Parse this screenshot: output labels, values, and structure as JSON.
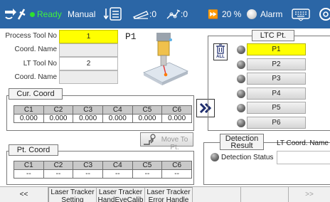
{
  "status_bar": {
    "ready_label": "Ready",
    "mode_label": "Manual",
    "count_a": ":0",
    "count_b": ":0",
    "speed_label": "20 %",
    "alarm_label": "Alarm"
  },
  "form": {
    "process_tool_label": "Process Tool No",
    "process_tool_value": "1",
    "coord_name_label_1": "Coord. Name",
    "coord_name_value_1": "",
    "lt_tool_label": "LT Tool No",
    "lt_tool_value": "2",
    "coord_name_label_2": "Coord. Name",
    "coord_name_value_2": "",
    "point_label": "P1"
  },
  "cur_coord": {
    "title": "Cur. Coord",
    "headers": [
      "C1",
      "C2",
      "C3",
      "C4",
      "C5",
      "C6"
    ],
    "values": [
      "0.000",
      "0.000",
      "0.000",
      "0.000",
      "0.000",
      "0.000"
    ]
  },
  "move_to_pt": {
    "label": "Move To Pt."
  },
  "pt_coord": {
    "title": "Pt. Coord",
    "headers": [
      "C1",
      "C2",
      "C3",
      "C4",
      "C5",
      "C6"
    ],
    "values": [
      "--",
      "--",
      "--",
      "--",
      "--",
      "--"
    ]
  },
  "ltc": {
    "title": "LTC Pt.",
    "delete_all_label": "ALL",
    "points": [
      "P1",
      "P2",
      "P3",
      "P4",
      "P5",
      "P6"
    ],
    "selected": "P1"
  },
  "detection": {
    "title_line1": "Detection",
    "title_line2": "Result",
    "status_label": "Detection Status",
    "lt_coord_label": "LT Coord. Name",
    "lt_coord_value": ""
  },
  "bottom_bar": {
    "prev_label": "<<",
    "tab1_line1": "Laser Tracker",
    "tab1_line2": "Setting",
    "tab2_line1": "Laser Tracker",
    "tab2_line2": "HandEyeCalib",
    "tab3_line1": "Laser Tracker",
    "tab3_line2": "Error Handle",
    "next_label": ">>"
  },
  "colors": {
    "top_bar": "#2b66a6",
    "ready_green": "#3ff03f",
    "selected_yellow": "#ffff00"
  }
}
